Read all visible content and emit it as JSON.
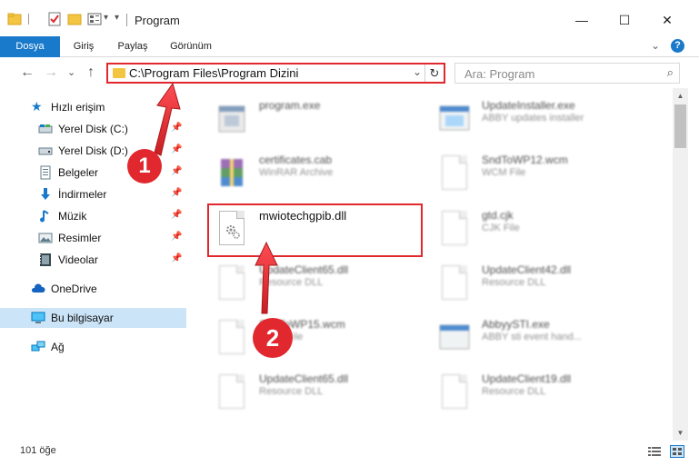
{
  "window": {
    "title": "Program",
    "minimize": "—",
    "maximize": "☐",
    "close": "✕"
  },
  "ribbon": {
    "tabs": [
      "Dosya",
      "Giriş",
      "Paylaş",
      "Görünüm"
    ]
  },
  "nav": {
    "back": "←",
    "forward": "→",
    "dropdown": "⌄",
    "up": "↑",
    "address": "C:\\Program Files\\Program Dizini",
    "address_dropdown": "⌄",
    "refresh": "↻",
    "search_placeholder": "Ara: Program",
    "search_icon": "⌕"
  },
  "sidebar": {
    "quick_access": "Hızlı erişim",
    "items": [
      {
        "label": "Yerel Disk (C:)",
        "icon": "drive-icon"
      },
      {
        "label": "Yerel Disk (D:)",
        "icon": "drive-icon"
      },
      {
        "label": "Belgeler",
        "icon": "documents-icon"
      },
      {
        "label": "İndirmeler",
        "icon": "downloads-icon"
      },
      {
        "label": "Müzik",
        "icon": "music-icon"
      },
      {
        "label": "Resimler",
        "icon": "pictures-icon"
      },
      {
        "label": "Videolar",
        "icon": "videos-icon"
      }
    ],
    "onedrive": "OneDrive",
    "this_pc": "Bu bilgisayar",
    "network": "Ağ"
  },
  "files": {
    "col1": [
      {
        "name": "program.exe",
        "type": ""
      },
      {
        "name": "certificates.cab",
        "type": "WinRAR Archive"
      },
      {
        "name": "mwiotechgpib.dll",
        "type": ""
      },
      {
        "name": "UpdateClient65.dll",
        "type": "Resource DLL"
      },
      {
        "name": "SndToWP15.wcm",
        "type": "WCM File"
      },
      {
        "name": "UpdateClient65.dll",
        "type": "Resource DLL"
      }
    ],
    "col2": [
      {
        "name": "UpdateInstaller.exe",
        "type": "ABBY updates installer"
      },
      {
        "name": "SndToWP12.wcm",
        "type": "WCM File"
      },
      {
        "name": "gtd.cjk",
        "type": "CJK File"
      },
      {
        "name": "UpdateClient42.dll",
        "type": "Resource DLL"
      },
      {
        "name": "AbbyySTI.exe",
        "type": "ABBY sti event hand..."
      },
      {
        "name": "UpdateClient19.dll",
        "type": "Resource DLL"
      }
    ]
  },
  "status": {
    "count": "101 öğe"
  },
  "annotations": {
    "marker1": "1",
    "marker2": "2"
  },
  "colors": {
    "accent": "#1979ca",
    "highlight": "#e0282e",
    "selected_bg": "#cce4f7"
  }
}
